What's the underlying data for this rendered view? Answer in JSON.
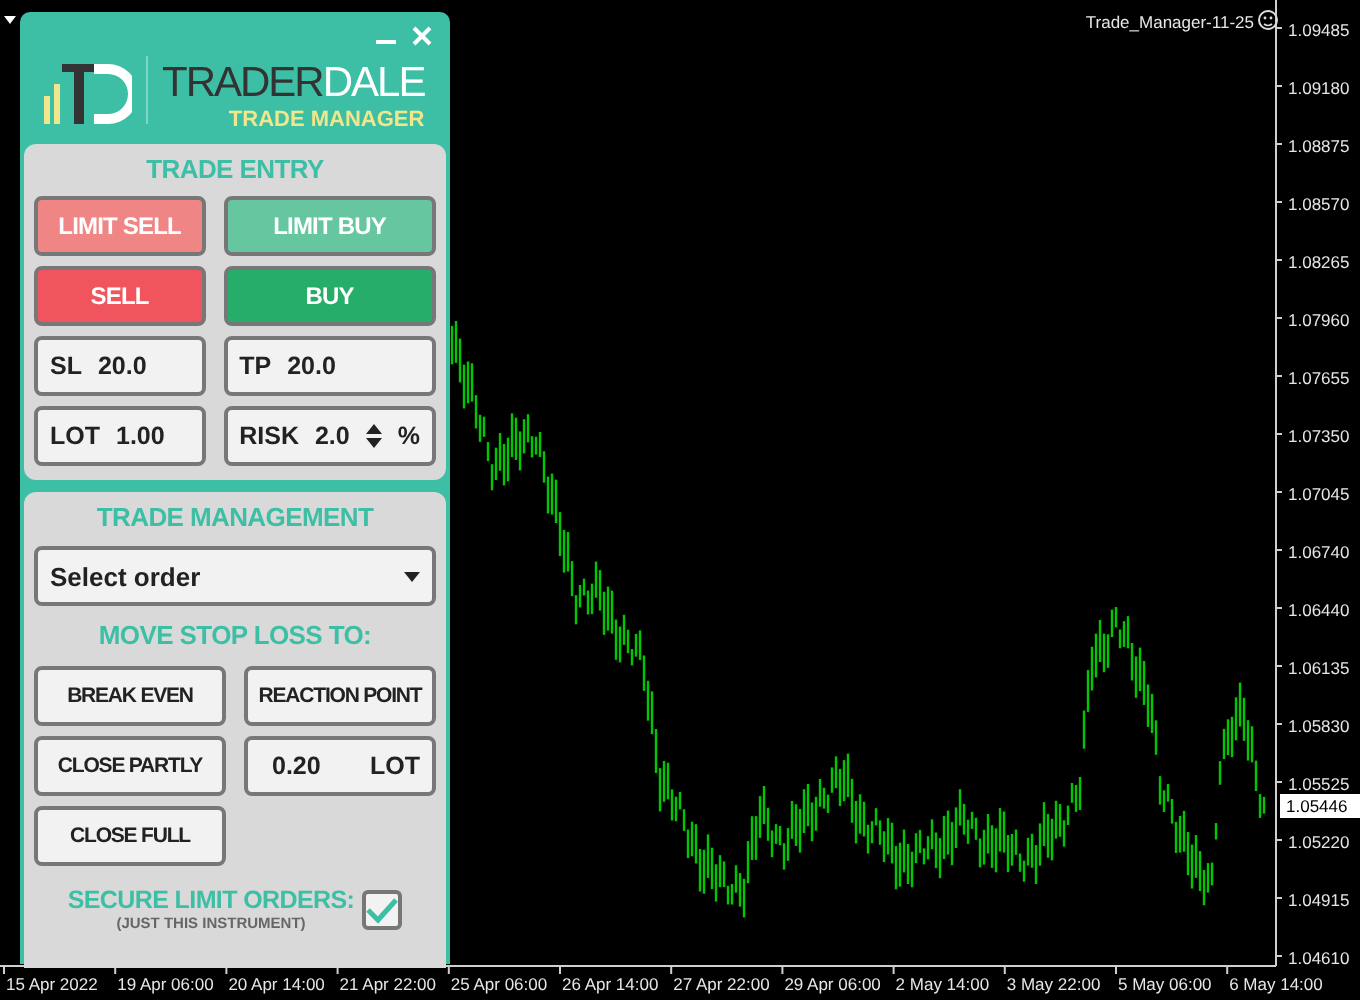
{
  "chart": {
    "indicator_label": "Trade_Manager-11-25",
    "price_labels": [
      "1.09485",
      "1.09180",
      "1.08875",
      "1.08570",
      "1.08265",
      "1.07960",
      "1.07655",
      "1.07350",
      "1.07045",
      "1.06740",
      "1.06440",
      "1.06135",
      "1.05830",
      "1.05525",
      "1.05220",
      "1.04915",
      "1.04610"
    ],
    "current_price": "1.05446",
    "time_labels": [
      "15 Apr 2022",
      "19 Apr 06:00",
      "20 Apr 14:00",
      "21 Apr 22:00",
      "25 Apr 06:00",
      "26 Apr 14:00",
      "27 Apr 22:00",
      "29 Apr 06:00",
      "2 May 14:00",
      "3 May 22:00",
      "5 May 06:00",
      "6 May 14:00"
    ]
  },
  "panel": {
    "brand": {
      "name_dark": "TRADER",
      "name_light": "DALE",
      "subtitle": "TRADE MANAGER"
    },
    "trade_entry": {
      "title": "TRADE ENTRY",
      "buttons": [
        {
          "label": "LIMIT SELL",
          "kind": "limit_sell"
        },
        {
          "label": "LIMIT BUY",
          "kind": "limit_buy"
        },
        {
          "label": "SELL",
          "kind": "sell"
        },
        {
          "label": "BUY",
          "kind": "buy"
        }
      ],
      "fields": [
        {
          "label": "SL",
          "value": "20.0"
        },
        {
          "label": "TP",
          "value": "20.0"
        },
        {
          "label": "LOT",
          "value": "1.00"
        },
        {
          "label": "RISK",
          "value": "2.0",
          "unit": "%",
          "spinner": true
        }
      ]
    },
    "trade_management": {
      "title": "TRADE MANAGEMENT",
      "order_select": {
        "value": "Select order"
      },
      "subtitle": "MOVE STOP LOSS TO:",
      "items": [
        {
          "kind": "button",
          "label": "BREAK EVEN"
        },
        {
          "kind": "button",
          "label": "REACTION POINT"
        },
        {
          "kind": "button",
          "label": "CLOSE PARTLY"
        },
        {
          "kind": "field",
          "value": "0.20",
          "unit": "LOT"
        },
        {
          "kind": "button",
          "label": "CLOSE FULL"
        }
      ],
      "secure": {
        "label": "SECURE LIMIT ORDERS:",
        "note": "(JUST THIS INSTRUMENT)",
        "checked": true
      }
    }
  }
}
